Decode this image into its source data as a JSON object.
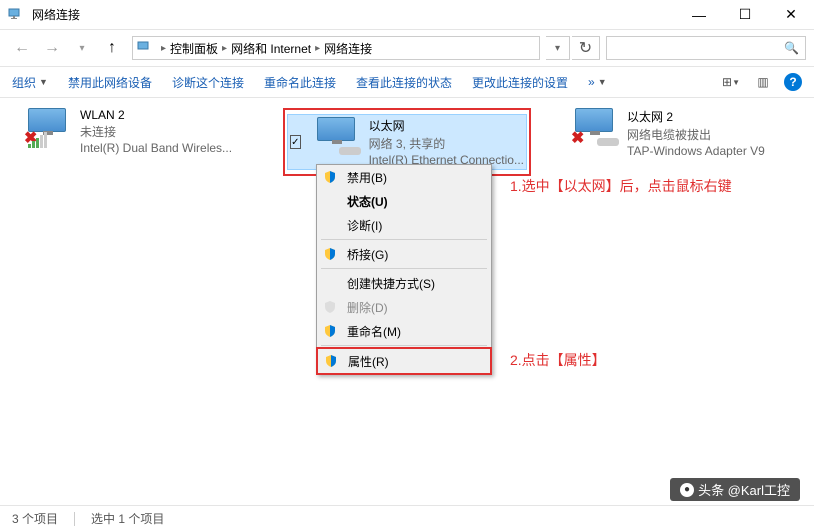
{
  "window": {
    "title": "网络连接"
  },
  "breadcrumb": {
    "items": [
      "控制面板",
      "网络和 Internet",
      "网络连接"
    ]
  },
  "search": {
    "placeholder": ""
  },
  "toolbar": {
    "organize": "组织",
    "disable": "禁用此网络设备",
    "diagnose": "诊断这个连接",
    "rename": "重命名此连接",
    "view_status": "查看此连接的状态",
    "change_settings": "更改此连接的设置"
  },
  "adapters": [
    {
      "name": "WLAN 2",
      "status": "未连接",
      "desc": "Intel(R) Dual Band Wireles..."
    },
    {
      "name": "以太网",
      "status": "网络 3, 共享的",
      "desc": "Intel(R) Ethernet Connectio..."
    },
    {
      "name": "以太网 2",
      "status": "网络电缆被拔出",
      "desc": "TAP-Windows Adapter V9"
    }
  ],
  "context_menu": {
    "items": [
      {
        "label": "禁用(B)",
        "shield": true
      },
      {
        "label": "状态(U)",
        "bold": true
      },
      {
        "label": "诊断(I)"
      },
      {
        "sep": true
      },
      {
        "label": "桥接(G)",
        "shield": true
      },
      {
        "sep": true
      },
      {
        "label": "创建快捷方式(S)"
      },
      {
        "label": "删除(D)",
        "shield": true,
        "disabled": true
      },
      {
        "label": "重命名(M)",
        "shield": true
      },
      {
        "sep": true
      },
      {
        "label": "属性(R)",
        "shield": true,
        "highlight": true
      }
    ]
  },
  "annotations": {
    "a1": "1.选中【以太网】后，点击鼠标右键",
    "a2": "2.点击【属性】"
  },
  "statusbar": {
    "count": "3 个项目",
    "selected": "选中 1 个项目"
  },
  "watermark": "头条 @Karl工控"
}
